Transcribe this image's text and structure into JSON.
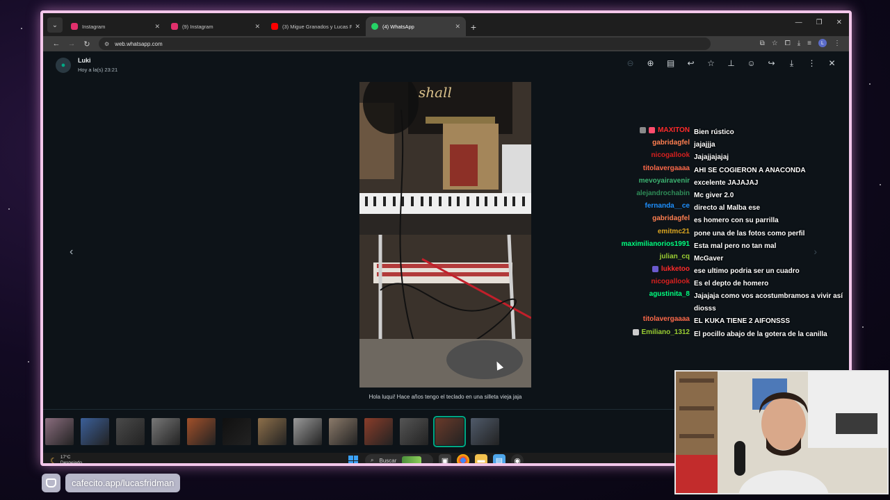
{
  "browser": {
    "tabs": [
      {
        "title": "Instagram",
        "color": "#e1306c",
        "active": false
      },
      {
        "title": "(9) Instagram",
        "color": "#e1306c",
        "active": false
      },
      {
        "title": "(3) Migue Granados y Lucas Fr...",
        "color": "#ff0000",
        "active": false
      },
      {
        "title": "(4) WhatsApp",
        "color": "#25d366",
        "active": true
      }
    ],
    "url": "web.whatsapp.com",
    "profile_initial": "L"
  },
  "viewer": {
    "sender": "Luki",
    "timestamp": "Hoy a la(s) 23:21",
    "caption": "Hola luqui! Hace años tengo el teclado en una silleta vieja jaja",
    "photo_sign": "shall",
    "thumbnail_count": 13,
    "selected_thumbnail": 11,
    "accent": "#00a884"
  },
  "taskbar": {
    "temperature": "17°C",
    "weather": "Despejado",
    "search": "Buscar"
  },
  "chat": [
    {
      "user": "MAXITON",
      "color": "#ff2a2a",
      "badges": [
        "#8a8a8a",
        "#ff4d6d"
      ],
      "text": "Bien rústico"
    },
    {
      "user": "gabridagfel",
      "color": "#ff7f50",
      "text": "jajajjja"
    },
    {
      "user": "nicogallook",
      "color": "#d6201f",
      "text": "Jajajjajajaj"
    },
    {
      "user": "titolavergaaaa",
      "color": "#ff6a4a",
      "text": "AHI SE COGIERON A ANACONDA"
    },
    {
      "user": "mevoyairavenir",
      "color": "#3cb371",
      "text": "excelente JAJAJAJ"
    },
    {
      "user": "alejandrochabin",
      "color": "#2e8b57",
      "text": "Mc giver 2.0"
    },
    {
      "user": "fernanda__ce",
      "color": "#1e90ff",
      "text": "directo al Malba ese"
    },
    {
      "user": "gabridagfel",
      "color": "#ff7f50",
      "text": "es homero con su parrilla"
    },
    {
      "user": "emitmc21",
      "color": "#daa520",
      "text": "pone una de las fotos como perfil"
    },
    {
      "user": "maximilianorios1991",
      "color": "#00ff7f",
      "text": "Esta mal pero no tan mal"
    },
    {
      "user": "julian_cq",
      "color": "#9acd32",
      "text": "McGaver"
    },
    {
      "user": "lukketoo",
      "color": "#ff2a2a",
      "badges": [
        "#6a5acd"
      ],
      "text": "ese ultimo podria ser un cuadro"
    },
    {
      "user": "nicogallook",
      "color": "#d6201f",
      "text": "Es el depto de homero"
    },
    {
      "user": "agustinita_8",
      "color": "#00ff7f",
      "text": "Jajajaja como vos acostumbramos a vivir así diosss"
    },
    {
      "user": "titolavergaaaa",
      "color": "#ff6a4a",
      "text": "EL KUKA TIENE 2 AIFONSSS"
    },
    {
      "user": "Emiliano_1312",
      "color": "#9acd32",
      "badges": [
        "#cccccc"
      ],
      "text": "El pocillo abajo de la gotera de la canilla"
    }
  ],
  "support": {
    "link": "cafecito.app/lucasfridman"
  }
}
